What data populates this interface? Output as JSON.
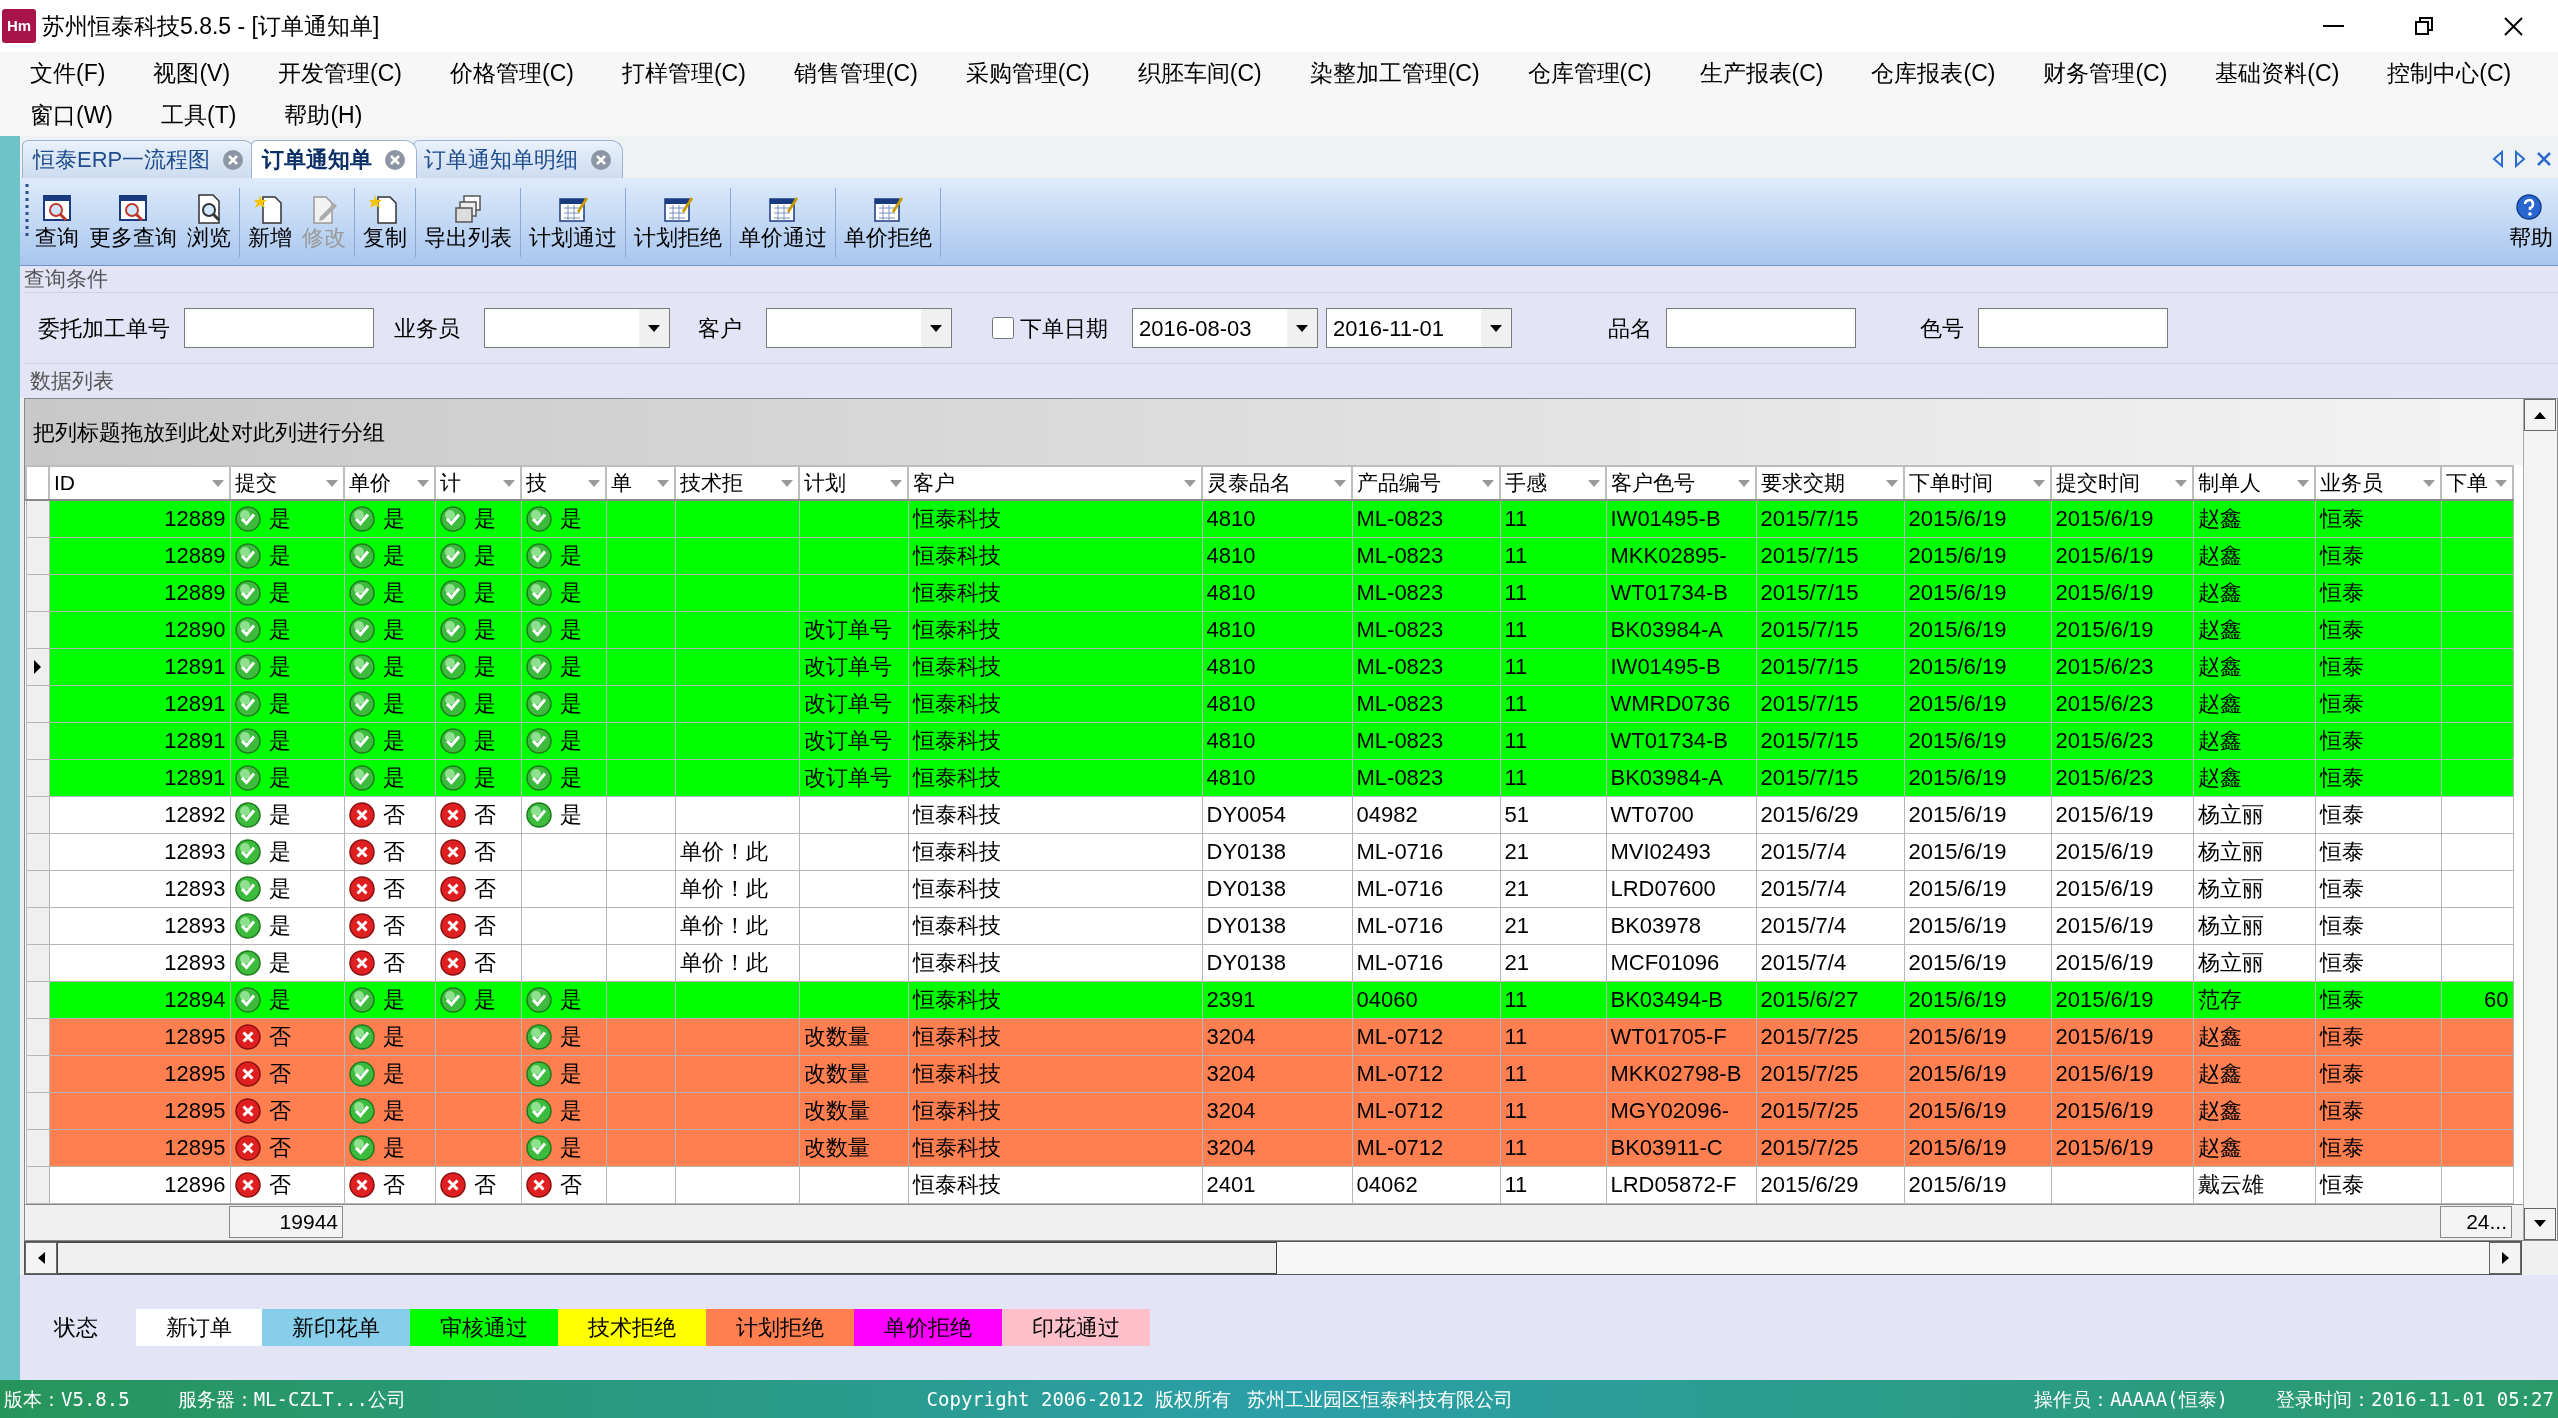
{
  "window": {
    "icon_text": "Hm",
    "title": "苏州恒泰科技5.8.5 - [订单通知单]"
  },
  "menu_rows": [
    [
      "文件(F)",
      "视图(V)",
      "开发管理(C)",
      "价格管理(C)",
      "打样管理(C)",
      "销售管理(C)",
      "采购管理(C)",
      "织胚车间(C)",
      "染整加工管理(C)",
      "仓库管理(C)",
      "生产报表(C)",
      "仓库报表(C)",
      "财务管理(C)",
      "基础资料(C)",
      "控制中心(C)"
    ],
    [
      "窗口(W)",
      "工具(T)",
      "帮助(H)"
    ]
  ],
  "tabs": [
    {
      "label": "恒泰ERP一流程图",
      "selected": false
    },
    {
      "label": "订单通知单",
      "selected": true
    },
    {
      "label": "订单通知单明细",
      "selected": false
    }
  ],
  "toolbar": {
    "groups": [
      [
        {
          "kind": "search",
          "label": "查询",
          "disabled": false
        },
        {
          "kind": "search",
          "label": "更多查询",
          "disabled": false
        },
        {
          "kind": "document-search",
          "label": "浏览",
          "disabled": false
        }
      ],
      [
        {
          "kind": "new-document",
          "label": "新增",
          "disabled": false
        },
        {
          "kind": "edit",
          "label": "修改",
          "disabled": true
        }
      ],
      [
        {
          "kind": "new-document",
          "label": "复制",
          "disabled": false
        }
      ],
      [
        {
          "kind": "export",
          "label": "导出列表",
          "disabled": false
        }
      ],
      [
        {
          "kind": "calendar-edit",
          "label": "计划通过",
          "disabled": false
        }
      ],
      [
        {
          "kind": "calendar-edit",
          "label": "计划拒绝",
          "disabled": false
        }
      ],
      [
        {
          "kind": "calendar-edit",
          "label": "单价通过",
          "disabled": false
        }
      ],
      [
        {
          "kind": "calendar-edit",
          "label": "单价拒绝",
          "disabled": false
        }
      ]
    ],
    "help": {
      "kind": "help",
      "label": "帮助"
    }
  },
  "query": {
    "title": "查询条件",
    "fields": [
      {
        "kind": "text",
        "label": "委托加工单号"
      },
      {
        "kind": "select",
        "label": "业务员"
      },
      {
        "kind": "select",
        "label": "客户"
      },
      {
        "kind": "date_range",
        "label": "下单日期",
        "checked": false,
        "from": "2016-08-03",
        "to": "2016-11-01"
      },
      {
        "kind": "text",
        "label": "品名"
      },
      {
        "kind": "text",
        "label": "色号"
      }
    ]
  },
  "data_list": {
    "title": "数据列表"
  },
  "table": {
    "group_hint": "把列标题拖放到此处对此列进行分组",
    "columns": [
      "ID",
      "提交",
      "单价",
      "计",
      "技",
      "单",
      "技术拒",
      "计划",
      "客户",
      "灵泰品名",
      "产品编号",
      "手感",
      "客户色号",
      "要求交期",
      "下单时间",
      "提交时间",
      "制单人",
      "业务员",
      "下单"
    ],
    "rows": [
      {
        "color": "#00ff00",
        "selected": false,
        "cells": [
          "12889",
          {
            "ok": true,
            "text": "是"
          },
          {
            "ok": true,
            "text": "是"
          },
          {
            "ok": true,
            "text": "是"
          },
          {
            "ok": true,
            "text": "是"
          },
          null,
          null,
          null,
          "恒泰科技",
          "4810",
          "ML-0823",
          "11",
          "IW01495-B",
          "2015/7/15",
          "2015/6/19",
          "2015/6/19",
          "赵鑫",
          "恒泰",
          null
        ]
      },
      {
        "color": "#00ff00",
        "selected": false,
        "cells": [
          "12889",
          {
            "ok": true,
            "text": "是"
          },
          {
            "ok": true,
            "text": "是"
          },
          {
            "ok": true,
            "text": "是"
          },
          {
            "ok": true,
            "text": "是"
          },
          null,
          null,
          null,
          "恒泰科技",
          "4810",
          "ML-0823",
          "11",
          "MKK02895-",
          "2015/7/15",
          "2015/6/19",
          "2015/6/19",
          "赵鑫",
          "恒泰",
          null
        ]
      },
      {
        "color": "#00ff00",
        "selected": false,
        "cells": [
          "12889",
          {
            "ok": true,
            "text": "是"
          },
          {
            "ok": true,
            "text": "是"
          },
          {
            "ok": true,
            "text": "是"
          },
          {
            "ok": true,
            "text": "是"
          },
          null,
          null,
          null,
          "恒泰科技",
          "4810",
          "ML-0823",
          "11",
          "WT01734-B",
          "2015/7/15",
          "2015/6/19",
          "2015/6/19",
          "赵鑫",
          "恒泰",
          null
        ]
      },
      {
        "color": "#00ff00",
        "selected": false,
        "cells": [
          "12890",
          {
            "ok": true,
            "text": "是"
          },
          {
            "ok": true,
            "text": "是"
          },
          {
            "ok": true,
            "text": "是"
          },
          {
            "ok": true,
            "text": "是"
          },
          null,
          null,
          "改订单号",
          "恒泰科技",
          "4810",
          "ML-0823",
          "11",
          "BK03984-A",
          "2015/7/15",
          "2015/6/19",
          "2015/6/19",
          "赵鑫",
          "恒泰",
          null
        ]
      },
      {
        "color": "#00ff00",
        "selected": true,
        "cells": [
          "12891",
          {
            "ok": true,
            "text": "是"
          },
          {
            "ok": true,
            "text": "是"
          },
          {
            "ok": true,
            "text": "是"
          },
          {
            "ok": true,
            "text": "是"
          },
          null,
          null,
          "改订单号",
          "恒泰科技",
          "4810",
          "ML-0823",
          "11",
          "IW01495-B",
          "2015/7/15",
          "2015/6/19",
          "2015/6/23",
          "赵鑫",
          "恒泰",
          null
        ]
      },
      {
        "color": "#00ff00",
        "selected": false,
        "cells": [
          "12891",
          {
            "ok": true,
            "text": "是"
          },
          {
            "ok": true,
            "text": "是"
          },
          {
            "ok": true,
            "text": "是"
          },
          {
            "ok": true,
            "text": "是"
          },
          null,
          null,
          "改订单号",
          "恒泰科技",
          "4810",
          "ML-0823",
          "11",
          "WMRD0736",
          "2015/7/15",
          "2015/6/19",
          "2015/6/23",
          "赵鑫",
          "恒泰",
          null
        ]
      },
      {
        "color": "#00ff00",
        "selected": false,
        "cells": [
          "12891",
          {
            "ok": true,
            "text": "是"
          },
          {
            "ok": true,
            "text": "是"
          },
          {
            "ok": true,
            "text": "是"
          },
          {
            "ok": true,
            "text": "是"
          },
          null,
          null,
          "改订单号",
          "恒泰科技",
          "4810",
          "ML-0823",
          "11",
          "WT01734-B",
          "2015/7/15",
          "2015/6/19",
          "2015/6/23",
          "赵鑫",
          "恒泰",
          null
        ]
      },
      {
        "color": "#00ff00",
        "selected": false,
        "cells": [
          "12891",
          {
            "ok": true,
            "text": "是"
          },
          {
            "ok": true,
            "text": "是"
          },
          {
            "ok": true,
            "text": "是"
          },
          {
            "ok": true,
            "text": "是"
          },
          null,
          null,
          "改订单号",
          "恒泰科技",
          "4810",
          "ML-0823",
          "11",
          "BK03984-A",
          "2015/7/15",
          "2015/6/19",
          "2015/6/23",
          "赵鑫",
          "恒泰",
          null
        ]
      },
      {
        "color": "#ffffff",
        "selected": false,
        "cells": [
          "12892",
          {
            "ok": true,
            "text": "是"
          },
          {
            "ok": false,
            "text": "否"
          },
          {
            "ok": false,
            "text": "否"
          },
          {
            "ok": true,
            "text": "是"
          },
          null,
          null,
          null,
          "恒泰科技",
          "DY0054",
          "04982",
          "51",
          "WT0700",
          "2015/6/29",
          "2015/6/19",
          "2015/6/19",
          "杨立丽",
          "恒泰",
          null
        ]
      },
      {
        "color": "#ffffff",
        "selected": false,
        "cells": [
          "12893",
          {
            "ok": true,
            "text": "是"
          },
          {
            "ok": false,
            "text": "否"
          },
          {
            "ok": false,
            "text": "否"
          },
          null,
          null,
          "单价！此",
          null,
          "恒泰科技",
          "DY0138",
          "ML-0716",
          "21",
          "MVI02493",
          "2015/7/4",
          "2015/6/19",
          "2015/6/19",
          "杨立丽",
          "恒泰",
          null
        ]
      },
      {
        "color": "#ffffff",
        "selected": false,
        "cells": [
          "12893",
          {
            "ok": true,
            "text": "是"
          },
          {
            "ok": false,
            "text": "否"
          },
          {
            "ok": false,
            "text": "否"
          },
          null,
          null,
          "单价！此",
          null,
          "恒泰科技",
          "DY0138",
          "ML-0716",
          "21",
          "LRD07600",
          "2015/7/4",
          "2015/6/19",
          "2015/6/19",
          "杨立丽",
          "恒泰",
          null
        ]
      },
      {
        "color": "#ffffff",
        "selected": false,
        "cells": [
          "12893",
          {
            "ok": true,
            "text": "是"
          },
          {
            "ok": false,
            "text": "否"
          },
          {
            "ok": false,
            "text": "否"
          },
          null,
          null,
          "单价！此",
          null,
          "恒泰科技",
          "DY0138",
          "ML-0716",
          "21",
          "BK03978",
          "2015/7/4",
          "2015/6/19",
          "2015/6/19",
          "杨立丽",
          "恒泰",
          null
        ]
      },
      {
        "color": "#ffffff",
        "selected": false,
        "cells": [
          "12893",
          {
            "ok": true,
            "text": "是"
          },
          {
            "ok": false,
            "text": "否"
          },
          {
            "ok": false,
            "text": "否"
          },
          null,
          null,
          "单价！此",
          null,
          "恒泰科技",
          "DY0138",
          "ML-0716",
          "21",
          "MCF01096",
          "2015/7/4",
          "2015/6/19",
          "2015/6/19",
          "杨立丽",
          "恒泰",
          null
        ]
      },
      {
        "color": "#00ff00",
        "selected": false,
        "cells": [
          "12894",
          {
            "ok": true,
            "text": "是"
          },
          {
            "ok": true,
            "text": "是"
          },
          {
            "ok": true,
            "text": "是"
          },
          {
            "ok": true,
            "text": "是"
          },
          null,
          null,
          null,
          "恒泰科技",
          "2391",
          "04060",
          "11",
          "BK03494-B",
          "2015/6/27",
          "2015/6/19",
          "2015/6/19",
          "范存",
          "恒泰",
          "60"
        ]
      },
      {
        "color": "#ff7f50",
        "selected": false,
        "cells": [
          "12895",
          {
            "ok": false,
            "text": "否"
          },
          {
            "ok": true,
            "text": "是"
          },
          null,
          {
            "ok": true,
            "text": "是"
          },
          null,
          null,
          "改数量",
          "恒泰科技",
          "3204",
          "ML-0712",
          "11",
          "WT01705-F",
          "2015/7/25",
          "2015/6/19",
          "2015/6/19",
          "赵鑫",
          "恒泰",
          null
        ]
      },
      {
        "color": "#ff7f50",
        "selected": false,
        "cells": [
          "12895",
          {
            "ok": false,
            "text": "否"
          },
          {
            "ok": true,
            "text": "是"
          },
          null,
          {
            "ok": true,
            "text": "是"
          },
          null,
          null,
          "改数量",
          "恒泰科技",
          "3204",
          "ML-0712",
          "11",
          "MKK02798-B",
          "2015/7/25",
          "2015/6/19",
          "2015/6/19",
          "赵鑫",
          "恒泰",
          null
        ]
      },
      {
        "color": "#ff7f50",
        "selected": false,
        "cells": [
          "12895",
          {
            "ok": false,
            "text": "否"
          },
          {
            "ok": true,
            "text": "是"
          },
          null,
          {
            "ok": true,
            "text": "是"
          },
          null,
          null,
          "改数量",
          "恒泰科技",
          "3204",
          "ML-0712",
          "11",
          "MGY02096-",
          "2015/7/25",
          "2015/6/19",
          "2015/6/19",
          "赵鑫",
          "恒泰",
          null
        ]
      },
      {
        "color": "#ff7f50",
        "selected": false,
        "cells": [
          "12895",
          {
            "ok": false,
            "text": "否"
          },
          {
            "ok": true,
            "text": "是"
          },
          null,
          {
            "ok": true,
            "text": "是"
          },
          null,
          null,
          "改数量",
          "恒泰科技",
          "3204",
          "ML-0712",
          "11",
          "BK03911-C",
          "2015/7/25",
          "2015/6/19",
          "2015/6/19",
          "赵鑫",
          "恒泰",
          null
        ]
      },
      {
        "color": "#ffffff",
        "selected": false,
        "cells": [
          "12896",
          {
            "ok": false,
            "text": "否"
          },
          {
            "ok": false,
            "text": "否"
          },
          {
            "ok": false,
            "text": "否"
          },
          {
            "ok": false,
            "text": "否"
          },
          null,
          null,
          null,
          "恒泰科技",
          "2401",
          "04062",
          "11",
          "LRD05872-F",
          "2015/6/29",
          "2015/6/19",
          null,
          "戴云雄",
          "恒泰",
          null
        ]
      }
    ],
    "footer_cells": [
      null,
      "19944",
      null,
      null,
      null,
      null,
      null,
      null,
      null,
      null,
      null,
      null,
      null,
      null,
      null,
      null,
      null,
      null,
      "24..."
    ]
  },
  "legend": {
    "label": "状态",
    "items": [
      {
        "label": "新订单",
        "color": "#ffffff"
      },
      {
        "label": "新印花单",
        "color": "#87ceeb"
      },
      {
        "label": "审核通过",
        "color": "#00ff00"
      },
      {
        "label": "技术拒绝",
        "color": "#ffff00"
      },
      {
        "label": "计划拒绝",
        "color": "#ff7f50"
      },
      {
        "label": "单价拒绝",
        "color": "#ff00ff"
      },
      {
        "label": "印花通过",
        "color": "#ffc0cb"
      }
    ]
  },
  "status_bar": {
    "version": "版本：V5.8.5",
    "server": "服务器：ML-CZLT...公司",
    "copyright": "Copyright 2006-2012 版权所有",
    "company": "苏州工业园区恒泰科技有限公司",
    "operator": "操作员：AAAAA(恒泰)",
    "login_time": "登录时间：2016-11-01 05:27"
  }
}
